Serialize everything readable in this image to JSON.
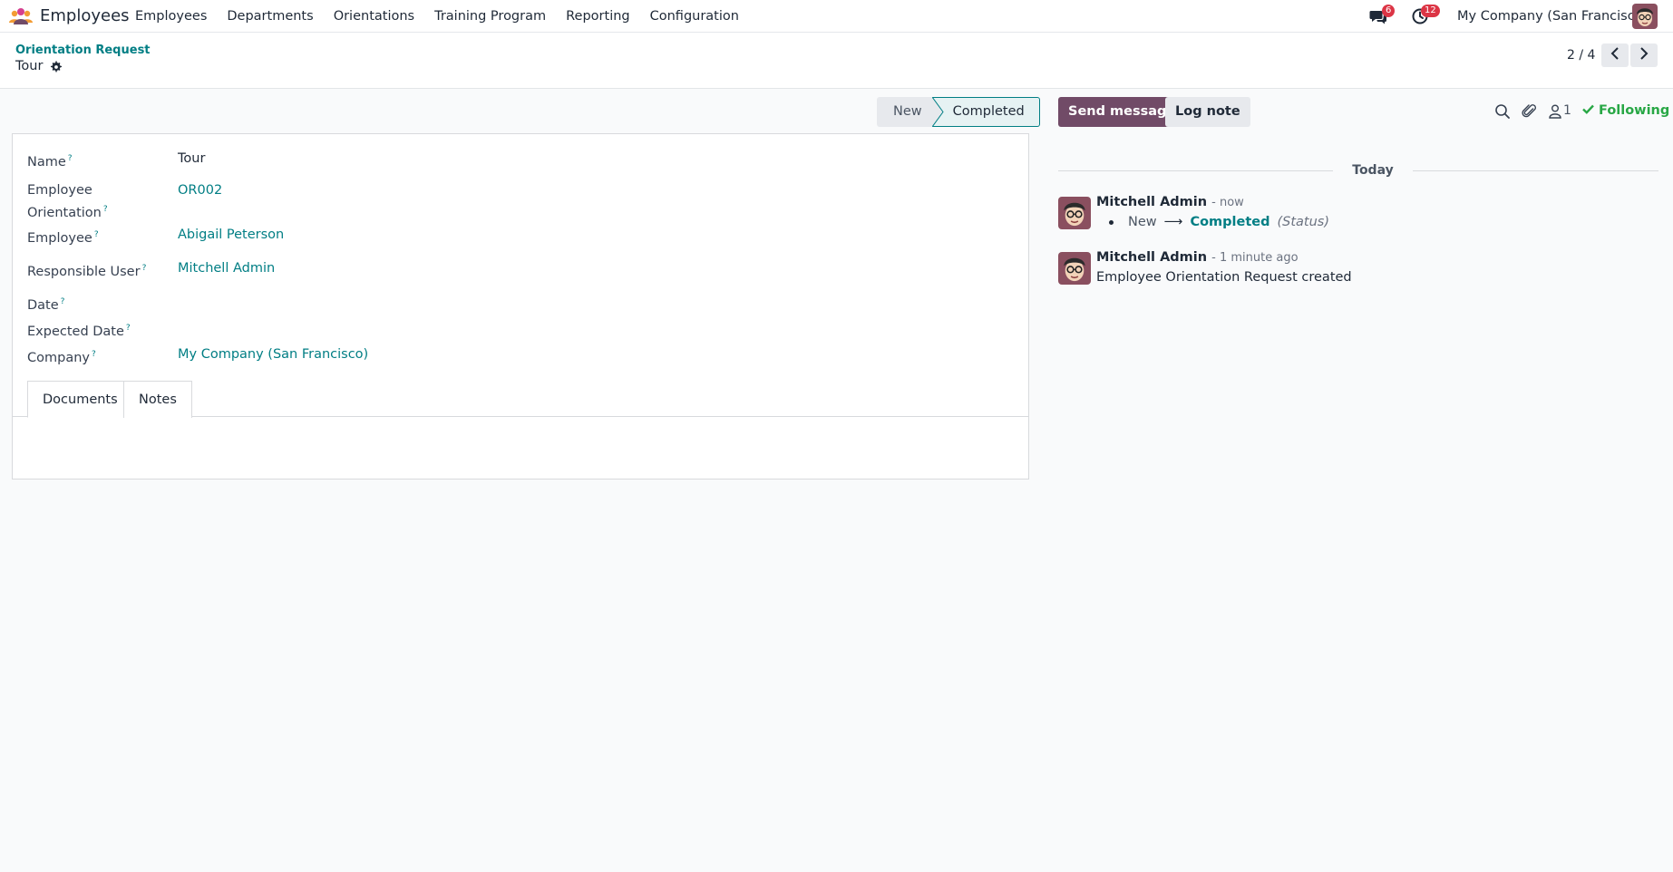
{
  "navbar": {
    "app_name": "Employees",
    "menu": [
      "Employees",
      "Departments",
      "Orientations",
      "Training Program",
      "Reporting",
      "Configuration"
    ],
    "messages_badge": "6",
    "activities_badge": "12",
    "company": "My Company (San Francisco)",
    "brand_color": "#714b67"
  },
  "control_panel": {
    "breadcrumb": "Orientation Request",
    "record_title": "Tour",
    "pager": "2 / 4"
  },
  "statusbar": {
    "stages": [
      "New",
      "Completed"
    ],
    "current": "Completed"
  },
  "form": {
    "fields": {
      "name": {
        "label": "Name",
        "value": "Tour"
      },
      "employee_orientation": {
        "label_line1": "Employee",
        "label_line2": "Orientation",
        "value": "OR002"
      },
      "employee": {
        "label": "Employee",
        "value": "Abigail Peterson"
      },
      "responsible_user": {
        "label": "Responsible User",
        "value": "Mitchell Admin"
      },
      "date": {
        "label": "Date",
        "value": ""
      },
      "expected_date": {
        "label": "Expected Date",
        "value": ""
      },
      "company": {
        "label": "Company",
        "value": "My Company (San Francisco)"
      }
    },
    "help_marker": "?",
    "tabs": [
      "Documents",
      "Notes"
    ],
    "active_tab": "Documents"
  },
  "chatter": {
    "send_message": "Send message",
    "log_note": "Log note",
    "followers_count": "1",
    "following": "Following",
    "date_separator": "Today",
    "messages": [
      {
        "author": "Mitchell Admin",
        "time": "- now",
        "tracking": {
          "old": "New",
          "arrow": "⟶",
          "new": "Completed",
          "field": "(Status)"
        }
      },
      {
        "author": "Mitchell Admin",
        "time": "- 1 minute ago",
        "body": "Employee Orientation Request created"
      }
    ]
  },
  "icons": {
    "app_logo": "employees-app-icon",
    "messages": "chat-bubbles-icon",
    "activities": "clock-icon",
    "record_settings": "gear-icon",
    "pager_prev": "chevron-left-icon",
    "pager_next": "chevron-right-icon",
    "search": "search-icon",
    "attachments": "paperclip-icon",
    "followers": "person-icon",
    "following_check": "check-icon"
  }
}
